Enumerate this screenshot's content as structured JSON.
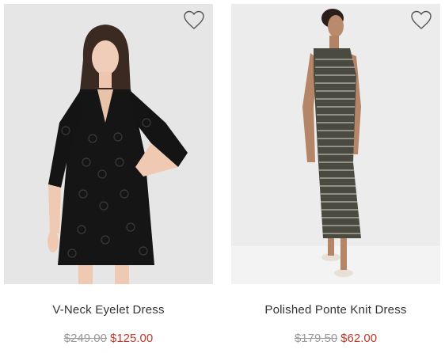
{
  "products": [
    {
      "name": "V-Neck Eyelet Dress",
      "original_price": "$249.00",
      "sale_price": "$125.00",
      "image": "model-in-black-eyelet-dress",
      "wishlist_icon": "heart-outline-icon"
    },
    {
      "name": "Polished Ponte Knit Dress",
      "original_price": "$179.50",
      "sale_price": "$62.00",
      "image": "model-in-striped-knit-dress",
      "wishlist_icon": "heart-outline-icon"
    }
  ],
  "colors": {
    "sale": "#c0392b",
    "original": "#9a9a9a",
    "text": "#333333"
  }
}
